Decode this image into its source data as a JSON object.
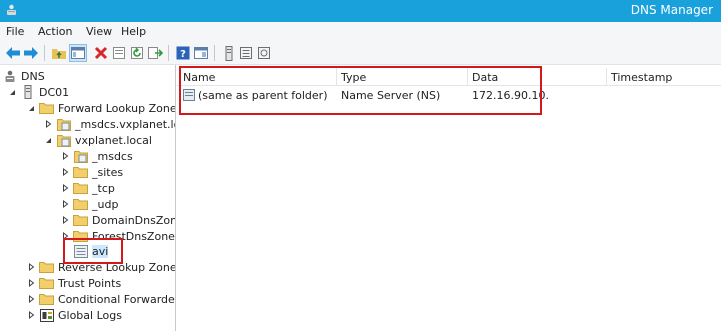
{
  "window": {
    "title": "DNS Manager",
    "app_icon": "dns-manager-icon"
  },
  "menu": {
    "items": [
      "File",
      "Action",
      "View",
      "Help"
    ]
  },
  "toolbar": {
    "buttons": [
      "back-arrow-icon",
      "forward-arrow-icon",
      "up-folder-icon",
      "show-hide-tree-icon",
      "delete-icon",
      "properties-icon",
      "refresh-icon",
      "export-list-icon",
      "help-icon",
      "mmc-console-icon",
      "server-icon",
      "zone-icon",
      "record-icon"
    ]
  },
  "tree": {
    "nodes": [
      {
        "label": "DNS",
        "icon": "dns-icon",
        "expander": "none"
      },
      {
        "label": "DC01",
        "icon": "server-icon",
        "expander": "expanded"
      },
      {
        "label": "Forward Lookup Zones",
        "icon": "folder-icon",
        "expander": "expanded"
      },
      {
        "label": "_msdcs.vxplanet.local",
        "icon": "zone-icon",
        "expander": "collapsed"
      },
      {
        "label": "vxplanet.local",
        "icon": "zone-icon",
        "expander": "expanded"
      },
      {
        "label": "_msdcs",
        "icon": "zone-icon",
        "expander": "collapsed"
      },
      {
        "label": "_sites",
        "icon": "folder-icon",
        "expander": "collapsed"
      },
      {
        "label": "_tcp",
        "icon": "folder-icon",
        "expander": "collapsed"
      },
      {
        "label": "_udp",
        "icon": "folder-icon",
        "expander": "collapsed"
      },
      {
        "label": "DomainDnsZones",
        "icon": "folder-icon",
        "expander": "collapsed"
      },
      {
        "label": "ForestDnsZones",
        "icon": "folder-icon",
        "expander": "collapsed"
      },
      {
        "label": "avi",
        "icon": "zone-icon",
        "expander": "none"
      },
      {
        "label": "Reverse Lookup Zones",
        "icon": "folder-icon",
        "expander": "collapsed"
      },
      {
        "label": "Trust Points",
        "icon": "folder-icon",
        "expander": "collapsed"
      },
      {
        "label": "Conditional Forwarders",
        "icon": "folder-icon",
        "expander": "collapsed"
      },
      {
        "label": "Global Logs",
        "icon": "event-log-icon",
        "expander": "collapsed"
      }
    ],
    "selected": "avi"
  },
  "list": {
    "columns": [
      "Name",
      "Type",
      "Data",
      "Timestamp"
    ],
    "rows": [
      {
        "name": "(same as parent folder)",
        "type": "Name Server (NS)",
        "data": "172.16.90.10.",
        "timestamp": "",
        "icon": "record-icon"
      }
    ]
  },
  "colors": {
    "titlebar": "#19a1dc",
    "highlight": "#d3191c",
    "selection": "#cce8ff"
  }
}
